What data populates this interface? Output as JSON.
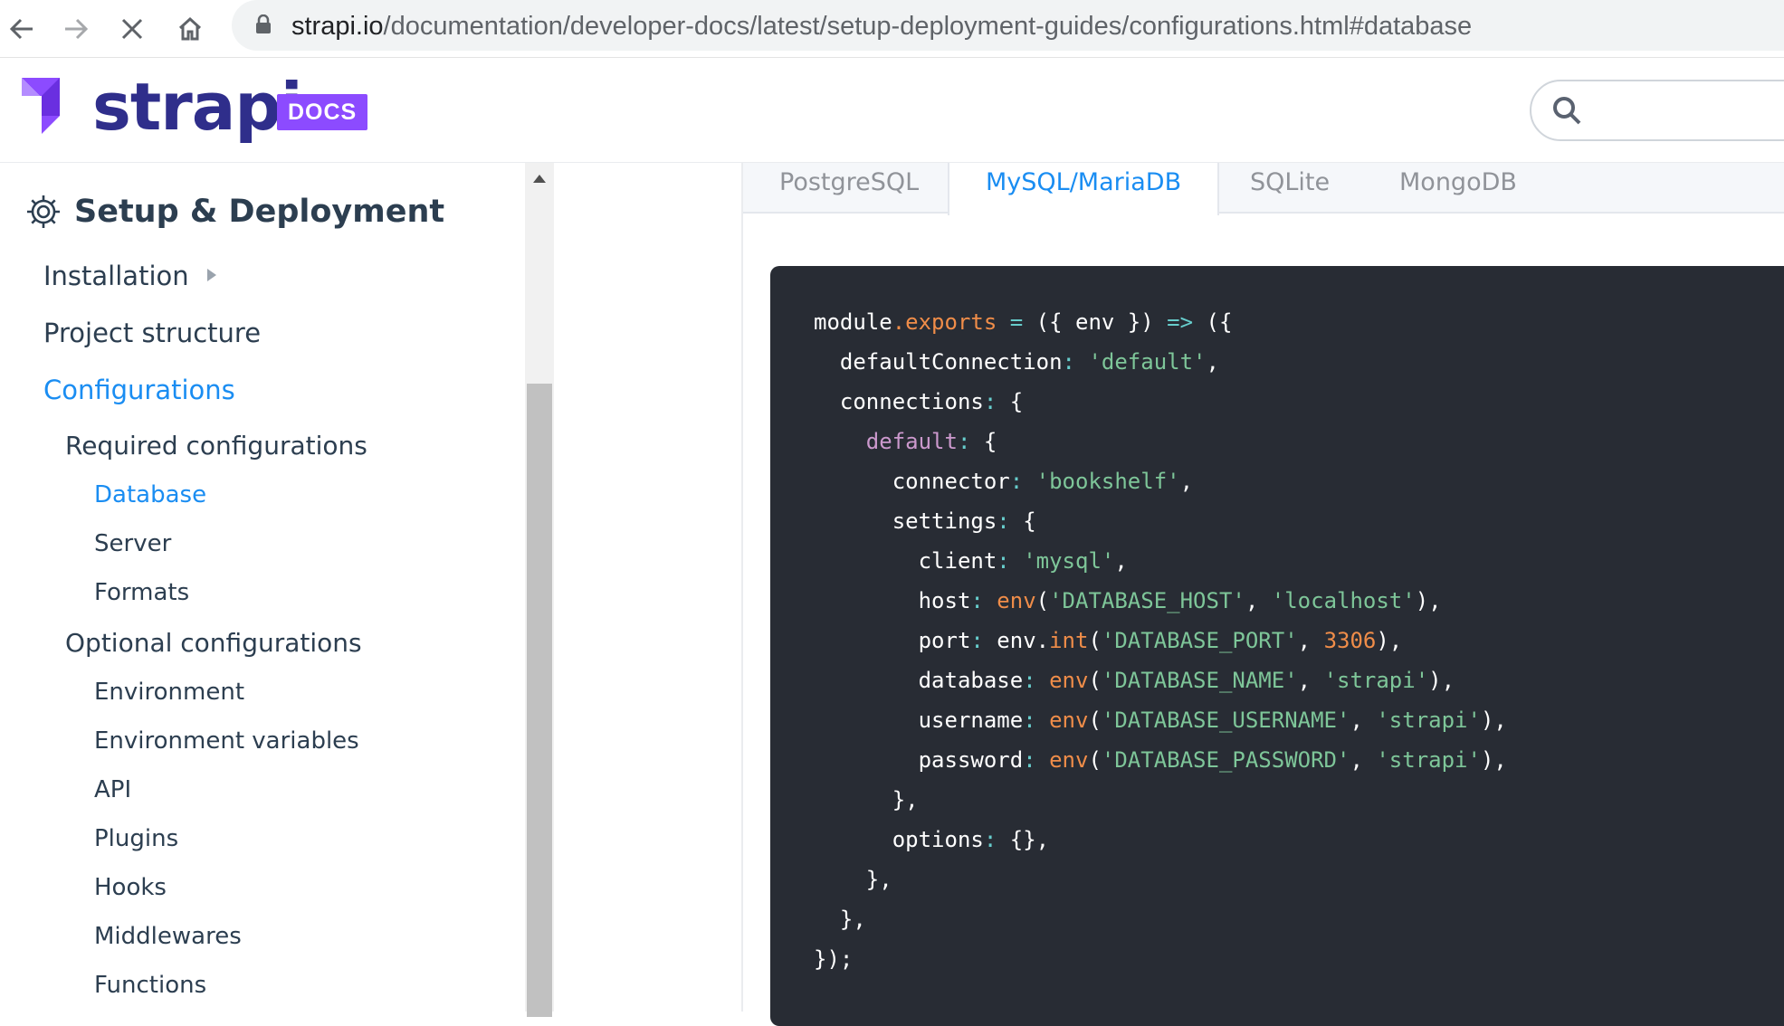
{
  "browser": {
    "url_host": "strapi.io",
    "url_path": "/documentation/developer-docs/latest/setup-deployment-guides/configurations.html#database"
  },
  "header": {
    "logo_text": "strapi",
    "badge": "DOCS",
    "search_placeholder": ""
  },
  "sidebar": {
    "section_title": "Setup & Deployment",
    "items": [
      {
        "label": "Installation",
        "level": 1,
        "has_children": true
      },
      {
        "label": "Project structure",
        "level": 1
      },
      {
        "label": "Configurations",
        "level": 1,
        "active": true
      },
      {
        "label": "Required configurations",
        "level": 2
      },
      {
        "label": "Database",
        "level": 3,
        "active": true
      },
      {
        "label": "Server",
        "level": 3
      },
      {
        "label": "Formats",
        "level": 3
      },
      {
        "label": "Optional configurations",
        "level": 2
      },
      {
        "label": "Environment",
        "level": 3
      },
      {
        "label": "Environment variables",
        "level": 3
      },
      {
        "label": "API",
        "level": 3
      },
      {
        "label": "Plugins",
        "level": 3
      },
      {
        "label": "Hooks",
        "level": 3
      },
      {
        "label": "Middlewares",
        "level": 3
      },
      {
        "label": "Functions",
        "level": 3
      }
    ]
  },
  "tabs": [
    {
      "label": "PostgreSQL"
    },
    {
      "label": "MySQL/MariaDB",
      "active": true
    },
    {
      "label": "SQLite"
    },
    {
      "label": "MongoDB"
    }
  ],
  "code": {
    "language": "javascript",
    "lines": [
      [
        [
          "p",
          "module"
        ],
        [
          "o",
          ".exports"
        ],
        [
          "p",
          " "
        ],
        [
          "a",
          "="
        ],
        [
          "p",
          " ({ env }) "
        ],
        [
          "a",
          "=>"
        ],
        [
          "p",
          " ({"
        ]
      ],
      [
        [
          "p",
          "  defaultConnection"
        ],
        [
          "a",
          ":"
        ],
        [
          "p",
          " "
        ],
        [
          "s",
          "'default'"
        ],
        [
          "p",
          ","
        ]
      ],
      [
        [
          "p",
          "  connections"
        ],
        [
          "a",
          ":"
        ],
        [
          "p",
          " {"
        ]
      ],
      [
        [
          "p",
          "    "
        ],
        [
          "k",
          "default"
        ],
        [
          "a",
          ":"
        ],
        [
          "p",
          " {"
        ]
      ],
      [
        [
          "p",
          "      connector"
        ],
        [
          "a",
          ":"
        ],
        [
          "p",
          " "
        ],
        [
          "s",
          "'bookshelf'"
        ],
        [
          "p",
          ","
        ]
      ],
      [
        [
          "p",
          "      settings"
        ],
        [
          "a",
          ":"
        ],
        [
          "p",
          " {"
        ]
      ],
      [
        [
          "p",
          "        client"
        ],
        [
          "a",
          ":"
        ],
        [
          "p",
          " "
        ],
        [
          "s",
          "'mysql'"
        ],
        [
          "p",
          ","
        ]
      ],
      [
        [
          "p",
          "        host"
        ],
        [
          "a",
          ":"
        ],
        [
          "p",
          " "
        ],
        [
          "o",
          "env"
        ],
        [
          "p",
          "("
        ],
        [
          "s",
          "'DATABASE_HOST'"
        ],
        [
          "p",
          ", "
        ],
        [
          "s",
          "'localhost'"
        ],
        [
          "p",
          "),"
        ]
      ],
      [
        [
          "p",
          "        port"
        ],
        [
          "a",
          ":"
        ],
        [
          "p",
          " env."
        ],
        [
          "o",
          "int"
        ],
        [
          "p",
          "("
        ],
        [
          "s",
          "'DATABASE_PORT'"
        ],
        [
          "p",
          ", "
        ],
        [
          "o",
          "3306"
        ],
        [
          "p",
          "),"
        ]
      ],
      [
        [
          "p",
          "        database"
        ],
        [
          "a",
          ":"
        ],
        [
          "p",
          " "
        ],
        [
          "o",
          "env"
        ],
        [
          "p",
          "("
        ],
        [
          "s",
          "'DATABASE_NAME'"
        ],
        [
          "p",
          ", "
        ],
        [
          "s",
          "'strapi'"
        ],
        [
          "p",
          "),"
        ]
      ],
      [
        [
          "p",
          "        username"
        ],
        [
          "a",
          ":"
        ],
        [
          "p",
          " "
        ],
        [
          "o",
          "env"
        ],
        [
          "p",
          "("
        ],
        [
          "s",
          "'DATABASE_USERNAME'"
        ],
        [
          "p",
          ", "
        ],
        [
          "s",
          "'strapi'"
        ],
        [
          "p",
          "),"
        ]
      ],
      [
        [
          "p",
          "        password"
        ],
        [
          "a",
          ":"
        ],
        [
          "p",
          " "
        ],
        [
          "o",
          "env"
        ],
        [
          "p",
          "("
        ],
        [
          "s",
          "'DATABASE_PASSWORD'"
        ],
        [
          "p",
          ", "
        ],
        [
          "s",
          "'strapi'"
        ],
        [
          "p",
          "),"
        ]
      ],
      [
        [
          "p",
          "      },"
        ]
      ],
      [
        [
          "p",
          "      options"
        ],
        [
          "a",
          ":"
        ],
        [
          "p",
          " {},"
        ]
      ],
      [
        [
          "p",
          "    },"
        ]
      ],
      [
        [
          "p",
          "  },"
        ]
      ],
      [
        [
          "p",
          "});"
        ]
      ]
    ]
  },
  "icons": {
    "back": "arrow-left-icon",
    "forward": "arrow-right-icon",
    "stop": "close-icon",
    "home": "home-icon",
    "lock": "lock-icon",
    "search": "search-icon",
    "section": "gear-icon"
  },
  "colors": {
    "accent": "#1a8df2",
    "brand": "#2f2e8b",
    "badge": "#8c4bff",
    "code_bg": "#282c34"
  }
}
